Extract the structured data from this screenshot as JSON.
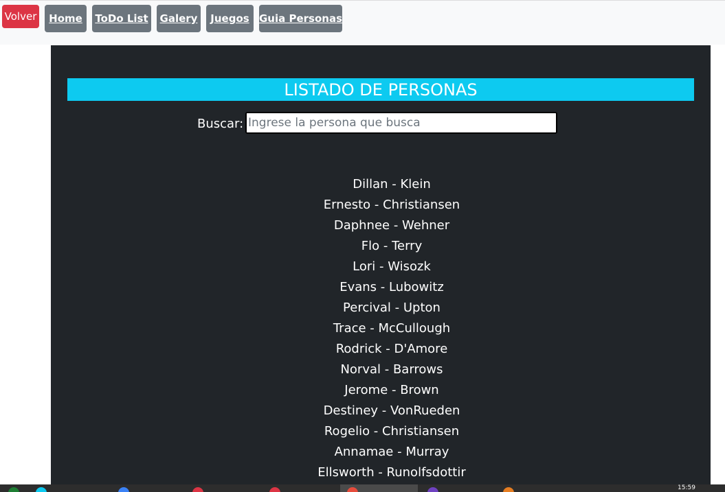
{
  "nav": {
    "volver_label": "Volver",
    "links": [
      {
        "label": "Home"
      },
      {
        "label": "ToDo List"
      },
      {
        "label": "Galery"
      },
      {
        "label": "Juegos"
      },
      {
        "label": "Guia Personas"
      }
    ]
  },
  "main": {
    "title": "LISTADO DE PERSONAS",
    "search": {
      "label": "Buscar:",
      "value": "",
      "placeholder": "Ingrese la persona que busca"
    },
    "people": [
      "Dillan - Klein",
      "Ernesto - Christiansen",
      "Daphnee - Wehner",
      "Flo - Terry",
      "Lori - Wisozk",
      "Evans - Lubowitz",
      "Percival - Upton",
      "Trace - McCullough",
      "Rodrick - D'Amore",
      "Norval - Barrows",
      "Jerome - Brown",
      "Destiney - VonRueden",
      "Rogelio - Christiansen",
      "Annamae - Murray",
      "Ellsworth - Runolfsdottir"
    ]
  },
  "taskbar": {
    "clock": "15:59",
    "icon_colors": [
      "#1e7e34",
      "#0dcaf0",
      "#3b82f6",
      "#dc3545",
      "#dc3545",
      "#e74c3c",
      "#6f42c1",
      "#e67e22"
    ]
  },
  "colors": {
    "accent": "#0dcaf0",
    "danger": "#dc3545",
    "secondary": "#6c757d",
    "dark": "#212529"
  }
}
